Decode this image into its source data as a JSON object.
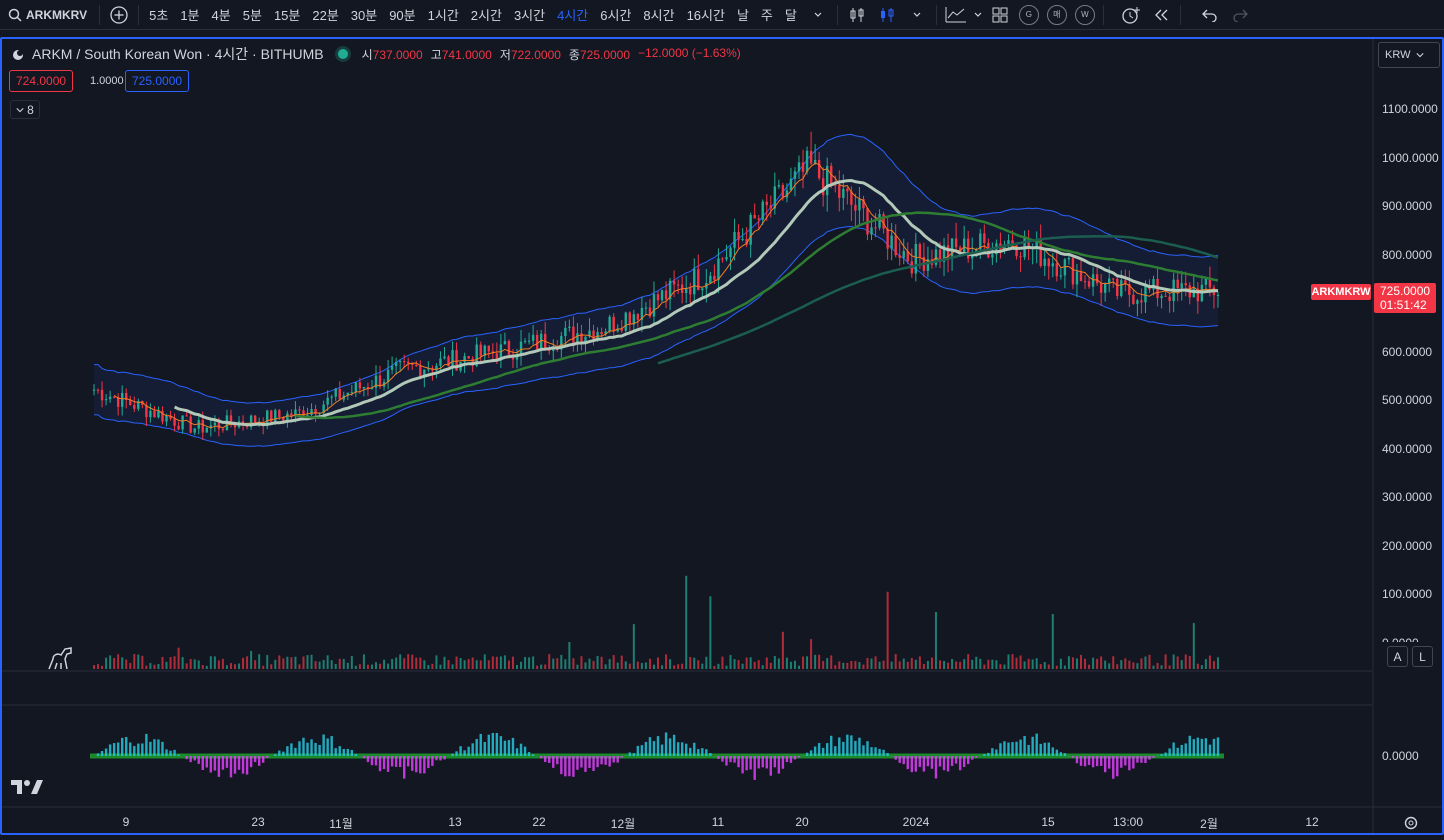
{
  "toolbar": {
    "symbol": "ARKMKRV",
    "intervals": [
      "5초",
      "1분",
      "4분",
      "5분",
      "15분",
      "22분",
      "30분",
      "90분",
      "1시간",
      "2시간",
      "3시간",
      "4시간",
      "6시간",
      "8시간",
      "16시간",
      "날",
      "주",
      "달"
    ],
    "active_interval": "4시간",
    "circle_buttons": [
      "G",
      "매",
      "W"
    ]
  },
  "legend": {
    "title": "ARKM / South Korean Won · 4시간 · BITHUMB",
    "open_label": "시",
    "open": "737.0000",
    "high_label": "고",
    "high": "741.0000",
    "low_label": "저",
    "low": "722.0000",
    "close_label": "종",
    "close": "725.0000",
    "change": "−12.0000 (−1.63%)"
  },
  "order": {
    "sell": "724.0000",
    "spread": "1.0000",
    "buy": "725.0000"
  },
  "collapsed_count": "8",
  "currency": "KRW",
  "price_axis": [
    "1100.0000",
    "1000.0000",
    "900.0000",
    "800.0000",
    "700.0000",
    "600.0000",
    "500.0000",
    "400.0000",
    "300.0000",
    "200.0000",
    "100.0000",
    "0.0000"
  ],
  "indicator_axis": "0.0000",
  "last_price": {
    "symbol": "ARKMKRW",
    "price": "725.0000",
    "countdown": "01:51:42"
  },
  "axis_buttons": [
    "A",
    "L"
  ],
  "time_axis": [
    "9",
    "23",
    "11월",
    "13",
    "22",
    "12월",
    "11",
    "20",
    "2024",
    "15",
    "13:00",
    "2월",
    "12"
  ],
  "colors": {
    "accent": "#2962ff",
    "up": "#22ab94",
    "down": "#f23645",
    "background": "#131722"
  },
  "chart_data": {
    "type": "line",
    "title": "ARKM / South Korean Won · 4시간 · BITHUMB",
    "xlabel": "",
    "ylabel": "",
    "ylim": [
      0,
      1100
    ],
    "x": [
      "9",
      "23",
      "11월",
      "13",
      "22",
      "12월",
      "11",
      "20",
      "2024",
      "15",
      "13:00",
      "2월"
    ],
    "series": [
      {
        "name": "price",
        "values": [
          520,
          440,
          470,
          560,
          600,
          650,
          760,
          980,
          790,
          830,
          720,
          725
        ]
      }
    ]
  }
}
